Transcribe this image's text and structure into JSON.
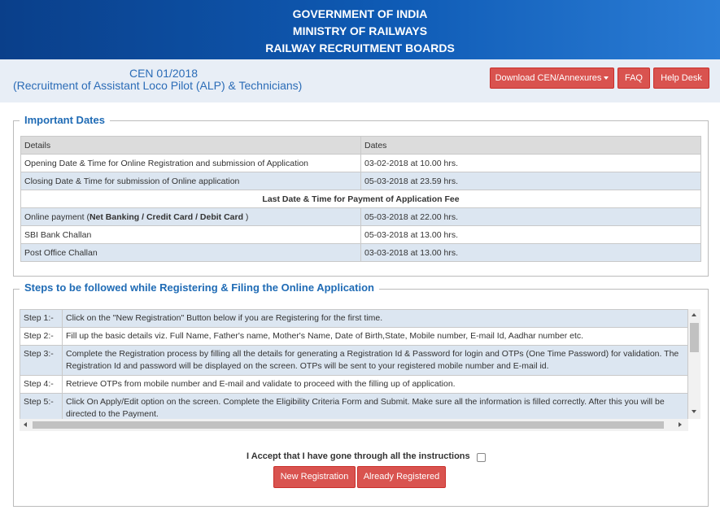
{
  "banner": {
    "line1": "GOVERNMENT OF INDIA",
    "line2": "MINISTRY OF RAILWAYS",
    "line3": "RAILWAY RECRUITMENT BOARDS"
  },
  "notice": {
    "cen": "CEN 01/2018",
    "subtitle": "(Recruitment of Assistant Loco Pilot (ALP) & Technicians)"
  },
  "nav": {
    "download": "Download CEN/Annexures",
    "faq": "FAQ",
    "help": "Help Desk"
  },
  "important_dates": {
    "legend": "Important Dates",
    "headers": [
      "Details",
      "Dates"
    ],
    "rows": [
      {
        "detail": "Opening Date & Time for Online Registration and submission of Application",
        "date": "03-02-2018 at 10.00 hrs."
      },
      {
        "detail": "Closing Date & Time for submission of Online application",
        "date": "05-03-2018 at 23.59 hrs."
      }
    ],
    "fee_heading": "Last Date & Time for Payment of Application Fee",
    "fee_rows": [
      {
        "detail_prefix": "Online payment (",
        "detail_bold": "Net Banking / Credit Card / Debit Card",
        "detail_suffix": " )",
        "date": "05-03-2018 at 22.00 hrs."
      },
      {
        "detail": "SBI Bank Challan",
        "date": "05-03-2018 at 13.00 hrs."
      },
      {
        "detail": "Post Office Challan",
        "date": "03-03-2018 at 13.00 hrs."
      }
    ]
  },
  "steps": {
    "legend": "Steps to be followed while Registering & Filing the Online Application",
    "items": [
      {
        "num": "Step 1:-",
        "text": "Click on the \"New Registration\" Button below if you are Registering for the first time."
      },
      {
        "num": "Step 2:-",
        "text": "Fill up the basic details viz. Full Name, Father's name, Mother's Name, Date of Birth,State, Mobile number, E-mail Id, Aadhar number etc."
      },
      {
        "num": "Step 3:-",
        "text": "Complete the Registration process by filling all the details for generating a Registration Id & Password for login and OTPs (One Time Password) for validation. The Registration Id and password will be displayed on the screen. OTPs will be sent to your registered mobile number and E-mail id."
      },
      {
        "num": "Step 4:-",
        "text": "Retrieve OTPs from mobile number and E-mail and validate to proceed with the filling up of application."
      },
      {
        "num": "Step 5:-",
        "text": "Click On Apply/Edit option on the screen. Complete the Eligibility Criteria Form and Submit. Make sure all the information is filled correctly. After this you will be directed to the Payment."
      }
    ]
  },
  "consent": {
    "label": "I Accept that I have gone through all the instructions",
    "new_registration": "New Registration",
    "already_registered": "Already Registered"
  },
  "colors": {
    "banner": "#0f5bb5",
    "button": "#d9534f",
    "accent_text": "#1f6bb5",
    "row_blue": "#dce6f1"
  }
}
